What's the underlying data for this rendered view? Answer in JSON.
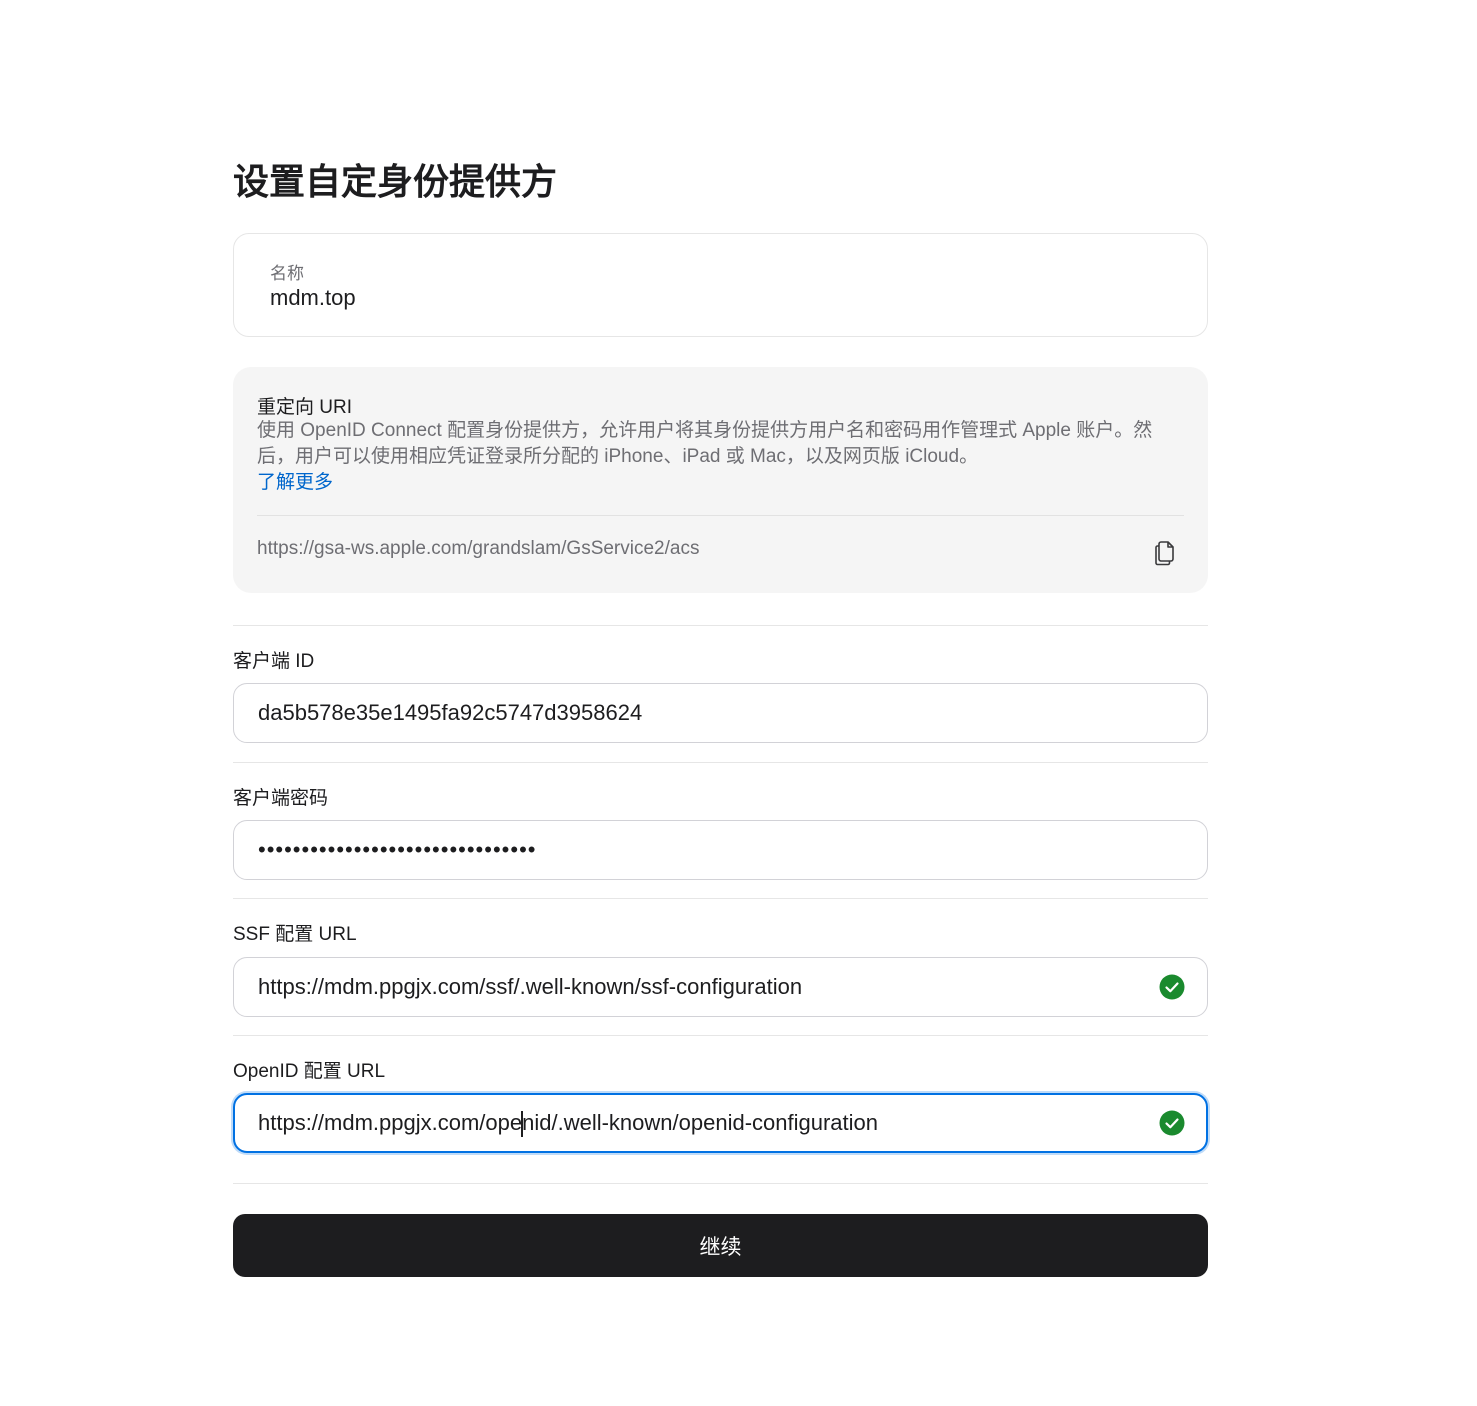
{
  "page": {
    "title": "设置自定身份提供方"
  },
  "name_card": {
    "label": "名称",
    "value": "mdm.top"
  },
  "redirect_card": {
    "heading": "重定向 URI",
    "description": "使用 OpenID Connect 配置身份提供方，允许用户将其身份提供方用户名和密码用作管理式 Apple 账户。然后，用户可以使用相应凭证登录所分配的 iPhone、iPad 或 Mac，以及网页版 iCloud。",
    "learn_more": "了解更多",
    "uri": "https://gsa-ws.apple.com/grandslam/GsService2/acs",
    "copy_icon": "copy-icon"
  },
  "fields": {
    "client_id": {
      "label": "客户端 ID",
      "value": "da5b578e35e1495fa92c5747d3958624"
    },
    "client_secret": {
      "label": "客户端密码",
      "value": "••••••••••••••••••••••••••••••••"
    },
    "ssf_url": {
      "label": "SSF 配置 URL",
      "value": "https://mdm.ppgjx.com/ssf/.well-known/ssf-configuration",
      "status_icon": "check-circle-icon"
    },
    "openid_url": {
      "label": "OpenID 配置 URL",
      "value_before_caret": "https://mdm.ppgjx.com/ope",
      "value_after_caret": "nid/.well-known/openid-configuration",
      "status_icon": "check-circle-icon"
    }
  },
  "actions": {
    "continue_label": "继续"
  },
  "colors": {
    "primary_button": "#1d1d1f",
    "link": "#0066cc",
    "success": "#1a8a2e",
    "focus": "#0071e3"
  }
}
